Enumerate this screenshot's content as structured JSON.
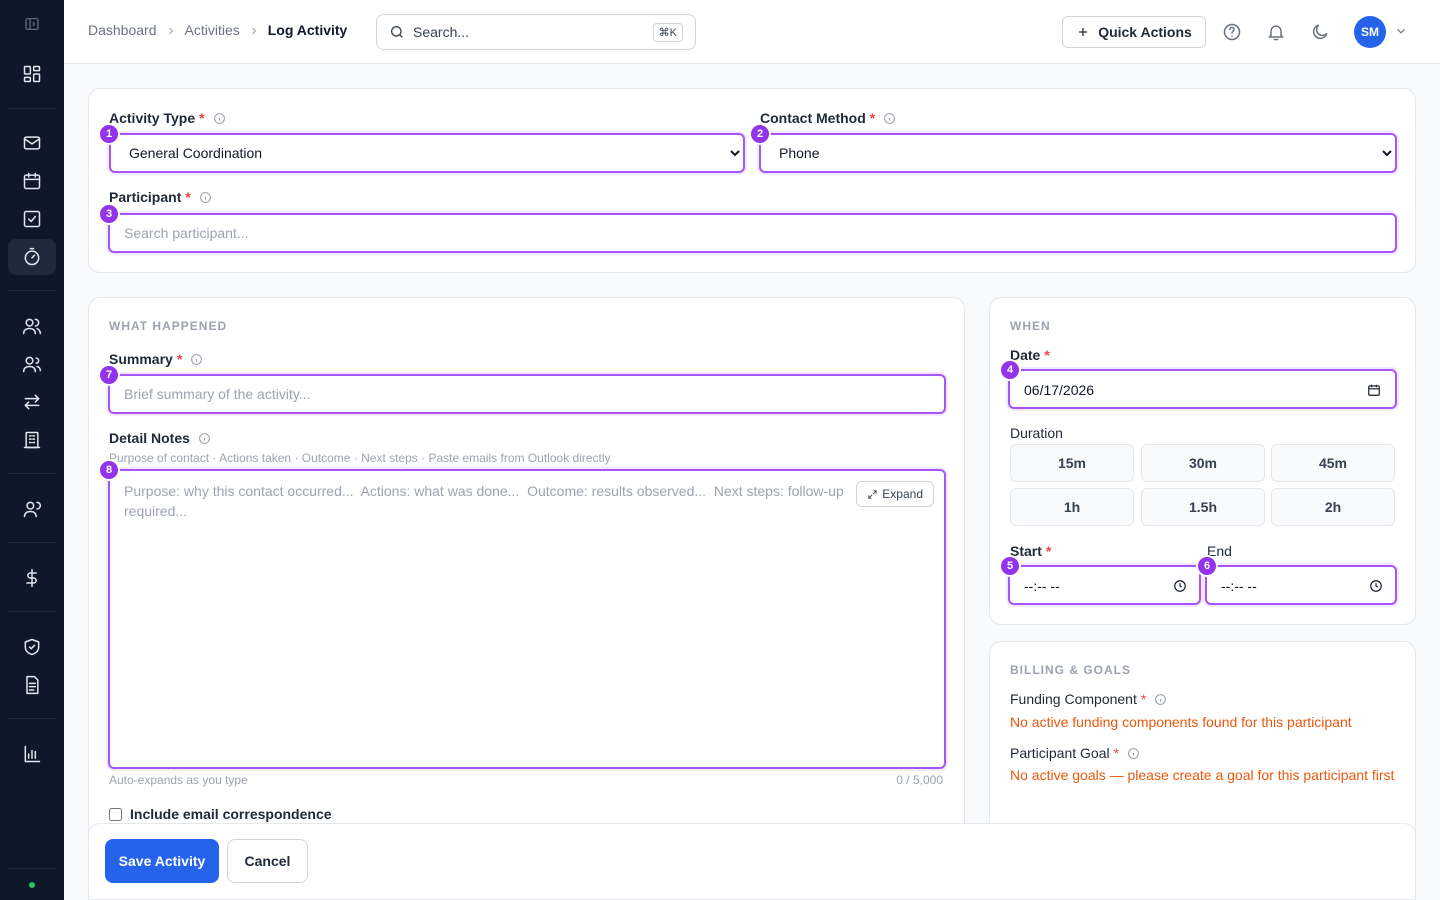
{
  "breadcrumb": {
    "items": [
      "Dashboard",
      "Activities"
    ],
    "current": "Log Activity"
  },
  "search": {
    "placeholder": "Search...",
    "shortcut": "⌘K"
  },
  "header": {
    "quick_actions": "Quick Actions",
    "avatar_initials": "SM"
  },
  "form": {
    "activity_type": {
      "label": "Activity Type",
      "value": "General Coordination",
      "step": "1"
    },
    "contact_method": {
      "label": "Contact Method",
      "value": "Phone",
      "step": "2"
    },
    "participant": {
      "label": "Participant",
      "placeholder": "Search participant...",
      "step": "3"
    },
    "required_mark": "*"
  },
  "what_happened": {
    "heading": "WHAT HAPPENED",
    "summary": {
      "label": "Summary",
      "placeholder": "Brief summary of the activity...",
      "step": "7"
    },
    "notes": {
      "label": "Detail Notes",
      "hint": "Purpose of contact · Actions taken · Outcome · Next steps · Paste emails from Outlook directly",
      "placeholder": "Purpose: why this contact occurred...  Actions: what was done...  Outcome: results observed...  Next steps: follow-up required...",
      "step": "8",
      "expand_label": "Expand",
      "auto_hint": "Auto-expands as you type",
      "counter": "0 / 5,000"
    },
    "include_email": "Include email correspondence"
  },
  "when": {
    "heading": "WHEN",
    "date": {
      "label": "Date",
      "value": "06/17/2026",
      "step": "4"
    },
    "duration": {
      "label": "Duration",
      "options": [
        "15m",
        "30m",
        "45m",
        "1h",
        "1.5h",
        "2h"
      ]
    },
    "start": {
      "label": "Start",
      "value": "--:-- --",
      "step": "5"
    },
    "end": {
      "label": "End",
      "value": "--:-- --",
      "step": "6"
    }
  },
  "billing": {
    "heading": "BILLING & GOALS",
    "funding": {
      "label": "Funding Component",
      "message": "No active funding components found for this participant"
    },
    "goal": {
      "label": "Participant Goal",
      "message": "No active goals — please create a goal for this participant first"
    }
  },
  "footer": {
    "save": "Save Activity",
    "cancel": "Cancel"
  },
  "colors": {
    "accent": "#9333ea",
    "primary": "#2563eb",
    "warning": "#ea580c",
    "sidebar": "#0f172a"
  },
  "sidebar_icons": [
    "collapse-icon",
    "grid-icon",
    "mail-icon",
    "calendar-icon",
    "checkbox-icon",
    "timer-icon",
    "users-icon",
    "group-icon",
    "transfer-icon",
    "building-icon",
    "team-icon",
    "dollar-icon",
    "shield-icon",
    "document-icon",
    "chart-icon"
  ]
}
